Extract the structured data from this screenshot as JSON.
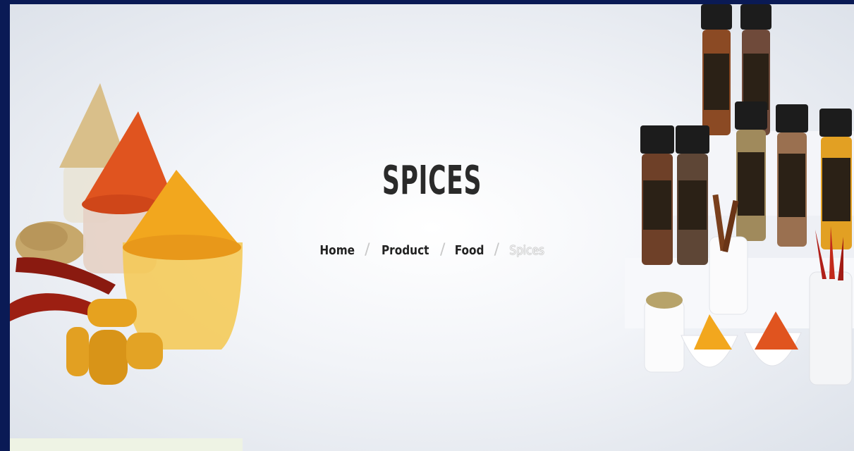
{
  "page": {
    "title": "SPICES",
    "breadcrumb": [
      {
        "label": "Home"
      },
      {
        "label": "Product"
      },
      {
        "label": "Food"
      },
      {
        "label": "Spices"
      }
    ]
  },
  "icons": {
    "left_image": "spice-bowls-image",
    "right_image": "spice-jars-image"
  },
  "colors": {
    "frame": "#0a1a55",
    "title": "#2a2a2a",
    "turmeric": "#f2a71e",
    "chili": "#e0541f",
    "cumin": "#d9bf8a"
  }
}
